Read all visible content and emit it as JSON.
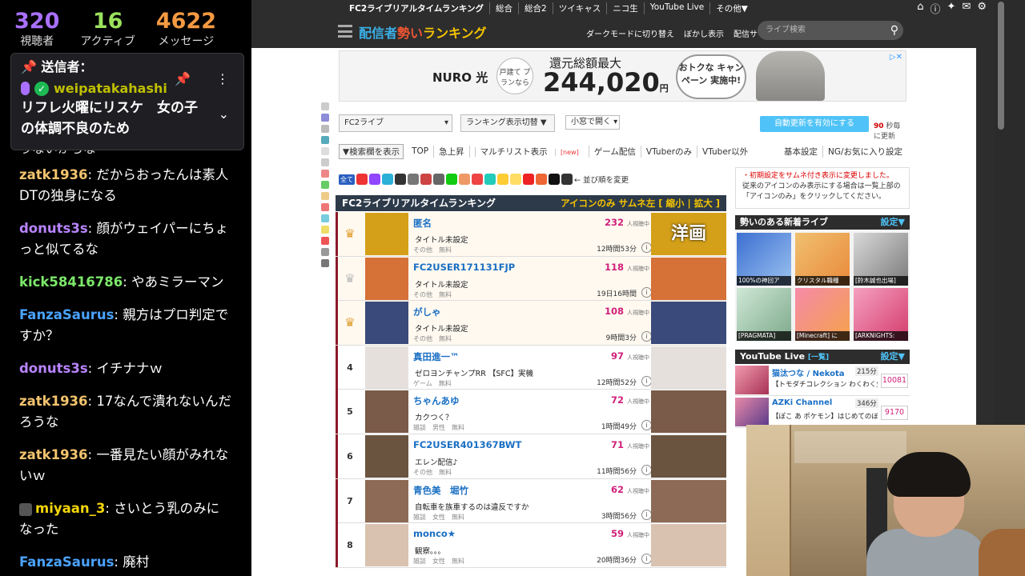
{
  "chat": {
    "stats": [
      {
        "value": "320",
        "label": "視聴者",
        "color": "#a970ff"
      },
      {
        "value": "16",
        "label": "アクティブ",
        "color": "#9be15d"
      },
      {
        "value": "4622",
        "label": "メッセージ",
        "color": "#f59a42"
      }
    ],
    "pinned": {
      "header": "送信者：",
      "user": "weipatakahashi",
      "message": "リフレ火曜にリスケ　女の子の体調不良のため"
    },
    "partial_line": "うないからな",
    "messages": [
      {
        "user": "zatk1936",
        "color": "#f3c46e",
        "text": ": だからおったんは素人DTの独身になる"
      },
      {
        "user": "donuts3s",
        "color": "#b884ff",
        "text": ": 顔がウェイパーにちょっと似てるな"
      },
      {
        "user": "kick58416786",
        "color": "#7ce86a",
        "text": ": やあミラーマン"
      },
      {
        "user": "FanzaSaurus",
        "color": "#4aa3ff",
        "text": ": 親方はプロ判定ですか？"
      },
      {
        "user": "donuts3s",
        "color": "#b884ff",
        "text": ": イチナナｗ"
      },
      {
        "user": "zatk1936",
        "color": "#f3c46e",
        "text": ": 17なんで潰れないんだろうな"
      },
      {
        "user": "zatk1936",
        "color": "#f3c46e",
        "text": ": 一番見たい顔がみれないｗ"
      },
      {
        "user": "miyaan_3",
        "color": "#f5d60a",
        "text": ": さいとう乳のみになった",
        "badge": true
      },
      {
        "user": "FanzaSaurus",
        "color": "#4aa3ff",
        "text": ": 廃村"
      }
    ]
  },
  "browser": {
    "topnav": [
      "FC2ライブリアルタイムランキング",
      "総合",
      "総合2",
      "ツイキャス",
      "ニコ生",
      "YouTube Live",
      "その他▼"
    ],
    "topnav_icons": [
      "home-icon",
      "info-icon",
      "twitter-icon",
      "mail-icon",
      "gear-icon"
    ],
    "logo": {
      "a": "配信者",
      "b": "勢い",
      "c": "ランキング"
    },
    "header_links": [
      "ダークモードに切り替え",
      "ぼかし表示",
      "配信サイト▾"
    ],
    "search_placeholder": "ライブ検索",
    "ad": {
      "brand": "NURO 光",
      "circle": "戸建て プランなら",
      "tagline": "還元総額最大",
      "amount": "244,020",
      "unit": "円",
      "bubble": "おトクな キャンペーン 実施中!"
    },
    "site_select": "FC2ライブ",
    "display_toggle": "ランキング表示切替 ▼",
    "window_select": "小窓で開く",
    "auto_update": "自動更新を有効にする",
    "auto_secs": "90",
    "auto_note": "秒毎に更新",
    "tabs_first": "▼検索欄を表示",
    "tabs": [
      "TOP",
      "急上昇",
      "マルチリスト表示"
    ],
    "tabs_new": "[new]",
    "tabs2": [
      "ゲーム配信",
      "VTuberのみ",
      "VTuber以外"
    ],
    "tabs_right": [
      "基本設定",
      "NG/お気に入り設定"
    ],
    "cat_all": "全て",
    "cat_sort": "← 並び順を変更",
    "rank_header": "FC2ライブリアルタイムランキング",
    "rank_opts": "アイコンのみ  サムネ左 [ 縮小 | 拡大 ]",
    "notice_red": "・初期設定をサムネ付き表示に変更しました。",
    "notice_text": "従来のアイコンのみ表示にする場合は一覧上部の「アイコンのみ」をクリックしてください。",
    "new_live_header": "勢いのある新着ライブ",
    "setting": "設定▼",
    "new_live": [
      "100%の神回ア",
      "クリスタル職種",
      "[鈴木誠也出場]",
      "[PRAGMATA]",
      "[Minecraft] に",
      "[ARKNIGHTS:"
    ],
    "yt_header": "YouTube Live",
    "yt_list": "[一覧]",
    "yt_items": [
      {
        "name": "猫汰つな / Nekota",
        "dur": "215分",
        "desc": "【トモダチコレクション わくわく生",
        "count": "10081"
      },
      {
        "name": "AZKi Channel",
        "dur": "346分",
        "desc": "【ぽこ あ ポケモン】はじめてのぼ",
        "count": "9170"
      }
    ],
    "viewers_unit": "人視聴中",
    "rows": [
      {
        "rank": "",
        "crown": "gold",
        "name": "匿名",
        "title": "タイトル未設定",
        "meta": "その他　無料",
        "viewers": "232",
        "time": "12時間53分",
        "thumb": "#d4a019",
        "thumb_text": "洋画"
      },
      {
        "rank": "",
        "crown": "silver",
        "name": "FC2USER171131FJP",
        "title": "タイトル未設定",
        "meta": "その他　無料",
        "viewers": "118",
        "time": "19日16時間",
        "thumb": "#d67138"
      },
      {
        "rank": "",
        "crown": "bronze",
        "name": "がしゃ",
        "title": "タイトル未設定",
        "meta": "その他　無料",
        "viewers": "108",
        "time": "9時間3分",
        "thumb": "#3a4a7a"
      },
      {
        "rank": "4",
        "name": "真田進一™",
        "title": "ゼロヨンチャンプRR 【SFC】実機",
        "meta": "ゲーム　無料",
        "viewers": "97",
        "time": "12時間52分",
        "thumb": "#e6e0dc"
      },
      {
        "rank": "5",
        "name": "ちゃんあゆ",
        "title": "カクつく？",
        "meta": "雑談　男性　無料",
        "viewers": "72",
        "time": "1時間49分",
        "thumb": "#7a5a48"
      },
      {
        "rank": "6",
        "name": "FC2USER401367BWT",
        "title": "エレン配信♪",
        "meta": "その他　無料",
        "viewers": "71",
        "time": "11時間56分",
        "thumb": "#6a5440"
      },
      {
        "rank": "7",
        "name": "青色美　堀竹",
        "title": "自転車を族車するのは違反ですか",
        "meta": "雑談　女性　無料",
        "viewers": "62",
        "time": "3時間56分",
        "thumb": "#8d6a55"
      },
      {
        "rank": "8",
        "name": "monco★",
        "title": "観察。。。",
        "meta": "雑談　女性　無料",
        "viewers": "59",
        "time": "20時間36分",
        "thumb": "#d9c3b0"
      }
    ]
  },
  "colors": {
    "chat_bg": "#000000",
    "nav_bg": "#2d2d2d",
    "accent_blue": "#4fc3f7",
    "rank_dark": "#2d3a4a",
    "viewer_pink": "#d0207a"
  }
}
